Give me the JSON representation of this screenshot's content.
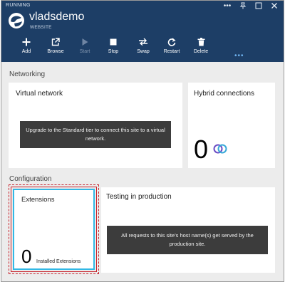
{
  "window": {
    "status": "RUNNING",
    "controls": [
      {
        "name": "more-options",
        "glyph": "•••"
      },
      {
        "name": "pin",
        "glyph": "pin"
      },
      {
        "name": "restore",
        "glyph": "restore"
      },
      {
        "name": "close",
        "glyph": "close"
      }
    ]
  },
  "site": {
    "name": "vladsdemo",
    "type": "WEBSITE"
  },
  "toolbar": {
    "buttons": [
      {
        "id": "add",
        "label": "Add",
        "icon": "plus-icon",
        "enabled": true
      },
      {
        "id": "browse",
        "label": "Browse",
        "icon": "external-link-icon",
        "enabled": true
      },
      {
        "id": "start",
        "label": "Start",
        "icon": "play-icon",
        "enabled": false
      },
      {
        "id": "stop",
        "label": "Stop",
        "icon": "stop-icon",
        "enabled": true
      },
      {
        "id": "swap",
        "label": "Swap",
        "icon": "swap-icon",
        "enabled": true
      },
      {
        "id": "restart",
        "label": "Restart",
        "icon": "restart-icon",
        "enabled": true
      },
      {
        "id": "delete",
        "label": "Delete",
        "icon": "trash-icon",
        "enabled": true
      }
    ],
    "more": "•••"
  },
  "networking": {
    "label": "Networking",
    "virtual_network": {
      "title": "Virtual network",
      "banner": "Upgrade to the Standard tier to connect this site to a virtual network."
    },
    "hybrid_connections": {
      "title": "Hybrid connections",
      "count": "0"
    }
  },
  "configuration": {
    "label": "Configuration",
    "extensions": {
      "title": "Extensions",
      "count": "0",
      "caption": "Installed Extensions"
    },
    "testing": {
      "title": "Testing in production",
      "banner": "All requests to this site's host name(s) get served by the production site."
    }
  },
  "colors": {
    "header_bg": "#1d3e66",
    "accent": "#31b8e5",
    "highlight": "#c7202a",
    "banner_bg": "#3c3c3c"
  }
}
